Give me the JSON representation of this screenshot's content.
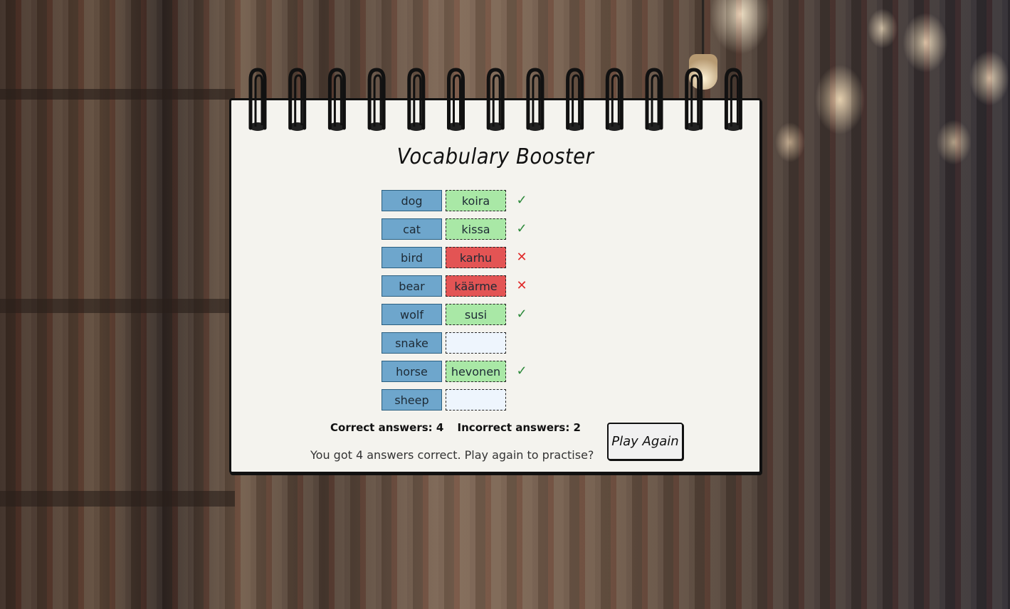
{
  "app": {
    "title": "Vocabulary Booster"
  },
  "vocab": [
    {
      "word": "dog",
      "answer": "koira",
      "status": "correct"
    },
    {
      "word": "cat",
      "answer": "kissa",
      "status": "correct"
    },
    {
      "word": "bird",
      "answer": "karhu",
      "status": "incorrect"
    },
    {
      "word": "bear",
      "answer": "käärme",
      "status": "incorrect"
    },
    {
      "word": "wolf",
      "answer": "susi",
      "status": "correct"
    },
    {
      "word": "snake",
      "answer": "",
      "status": "empty"
    },
    {
      "word": "horse",
      "answer": "hevonen",
      "status": "correct"
    },
    {
      "word": "sheep",
      "answer": "",
      "status": "empty"
    }
  ],
  "icons": {
    "correct": "check-icon",
    "incorrect": "cross-icon"
  },
  "colors": {
    "word_bg": "#6ea6cc",
    "correct_bg": "#a9e8a6",
    "incorrect_bg": "#e35454",
    "empty_bg": "#eef5fd",
    "check": "#2e8a3c",
    "cross": "#e02a2a"
  },
  "score": {
    "correct_label": "Correct answers: 4",
    "incorrect_label": "Incorrect answers: 2"
  },
  "result_message": "You got 4 answers correct. Play again to practise?",
  "play_again_label": "Play Again"
}
